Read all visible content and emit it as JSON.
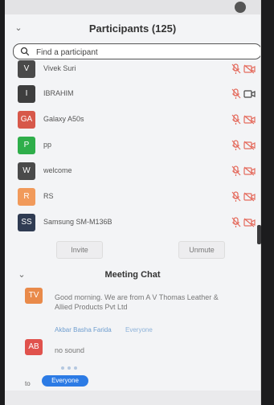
{
  "header": {
    "title": "Participants (125)"
  },
  "search": {
    "placeholder": "Find a participant"
  },
  "participants": [
    {
      "initials": "V",
      "name": "Vivek Suri",
      "color": "#4a4a4a",
      "mic_muted": true,
      "video_off": true
    },
    {
      "initials": "I",
      "name": "IBRAHIM",
      "color": "#3e3e3e",
      "mic_muted": true,
      "video_off": false
    },
    {
      "initials": "GA",
      "name": "Galaxy A50s",
      "color": "#d7584a",
      "mic_muted": true,
      "video_off": true
    },
    {
      "initials": "P",
      "name": "pp",
      "color": "#2fae4a",
      "mic_muted": true,
      "video_off": true
    },
    {
      "initials": "W",
      "name": "welcome",
      "color": "#4a4a4a",
      "mic_muted": true,
      "video_off": true
    },
    {
      "initials": "R",
      "name": "RS",
      "color": "#f19a5b",
      "mic_muted": true,
      "video_off": true
    },
    {
      "initials": "SS",
      "name": "Samsung SM-M136B",
      "color": "#2f3b52",
      "mic_muted": true,
      "video_off": true
    }
  ],
  "actions": {
    "invite_label": "Invite",
    "unmute_label": "Unmute"
  },
  "chat": {
    "title": "Meeting Chat",
    "messages": [
      {
        "initials": "TV",
        "color": "#e98a4a",
        "text": "Good morning. We are from A V Thomas Leather & Allied Products Pvt Ltd"
      },
      {
        "initials": "AB",
        "color": "#e0524d",
        "sender": "Akbar Basha Farida",
        "recipient": "Everyone",
        "text": "no sound"
      }
    ],
    "to_label": "to",
    "to_value": "Everyone"
  },
  "colors": {
    "accent": "#2c7be5",
    "muted_icon": "#e46a5c",
    "link": "#6f9ecf"
  }
}
